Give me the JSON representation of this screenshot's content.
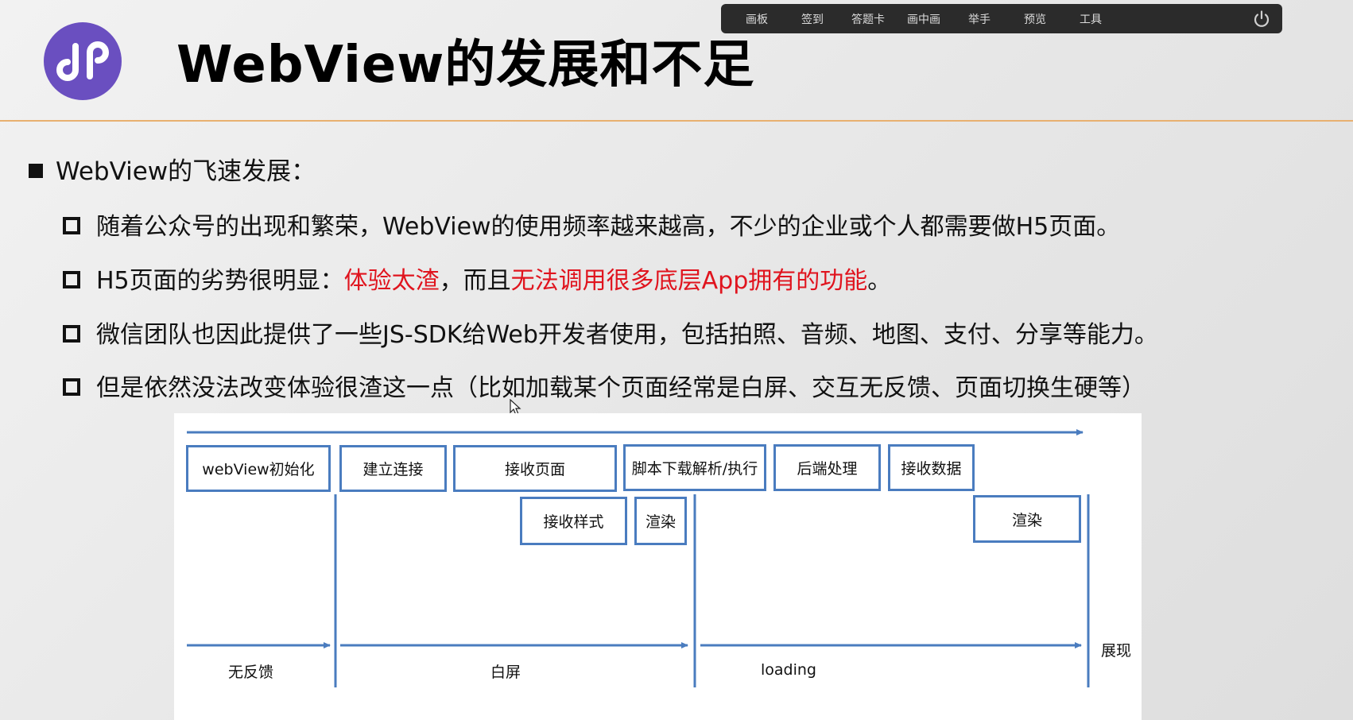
{
  "title": "WebView的发展和不足",
  "toolbar": {
    "items": [
      "画板",
      "签到",
      "答题卡",
      "画中画",
      "举手",
      "预览",
      "工具"
    ]
  },
  "content": {
    "main_bullet": "WebView的飞速发展：",
    "line1": "随着公众号的出现和繁荣，WebView的使用频率越来越高，不少的企业或个人都需要做H5页面。",
    "line2": {
      "a": "H5页面的劣势很明显：",
      "b": "体验太渣",
      "c": "，而且",
      "d": "无法调用很多底层App拥有的功能",
      "e": "。"
    },
    "line3": "微信团队也因此提供了一些JS-SDK给Web开发者使用，包括拍照、音频、地图、支付、分享等能力。",
    "line4": "但是依然没法改变体验很渣这一点（比如加载某个页面经常是白屏、交互无反馈、页面切换生硬等）"
  },
  "diagram": {
    "row1": [
      "webView初始化",
      "建立连接",
      "接收页面",
      "脚本下载解析/执行",
      "后端处理",
      "接收数据"
    ],
    "row2": [
      "接收样式",
      "渲染",
      "渲染"
    ],
    "phases": [
      "无反馈",
      "白屏",
      "loading"
    ],
    "end_label": "展现"
  },
  "colors": {
    "accent_red": "#e0141e",
    "diagram_blue": "#4a7cbf",
    "logo_purple": "#6a4fc0",
    "header_rule": "#e8b070"
  }
}
